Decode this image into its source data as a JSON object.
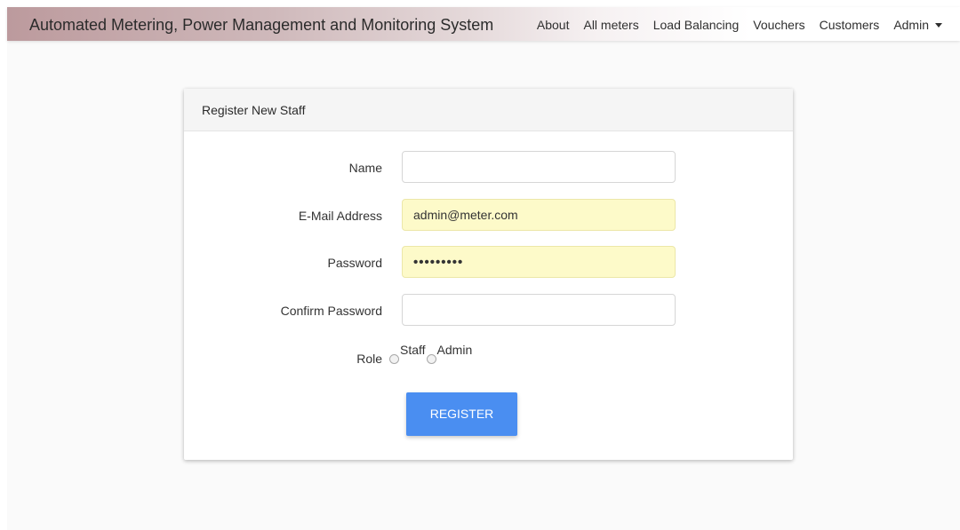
{
  "navbar": {
    "brand": "Automated Metering, Power Management and Monitoring System",
    "links": [
      "About",
      "All meters",
      "Load Balancing",
      "Vouchers",
      "Customers"
    ],
    "user_menu": "Admin"
  },
  "form": {
    "title": "Register New Staff",
    "name_label": "Name",
    "name_value": "",
    "email_label": "E-Mail Address",
    "email_value": "admin@meter.com",
    "password_label": "Password",
    "password_value": "•••••••••",
    "confirm_label": "Confirm Password",
    "confirm_value": "",
    "role_label": "Role",
    "role_options": [
      "Staff",
      "Admin"
    ],
    "submit_label": "REGISTER"
  },
  "colors": {
    "button": "#4a8ef1",
    "autofill": "#fdfac9"
  }
}
